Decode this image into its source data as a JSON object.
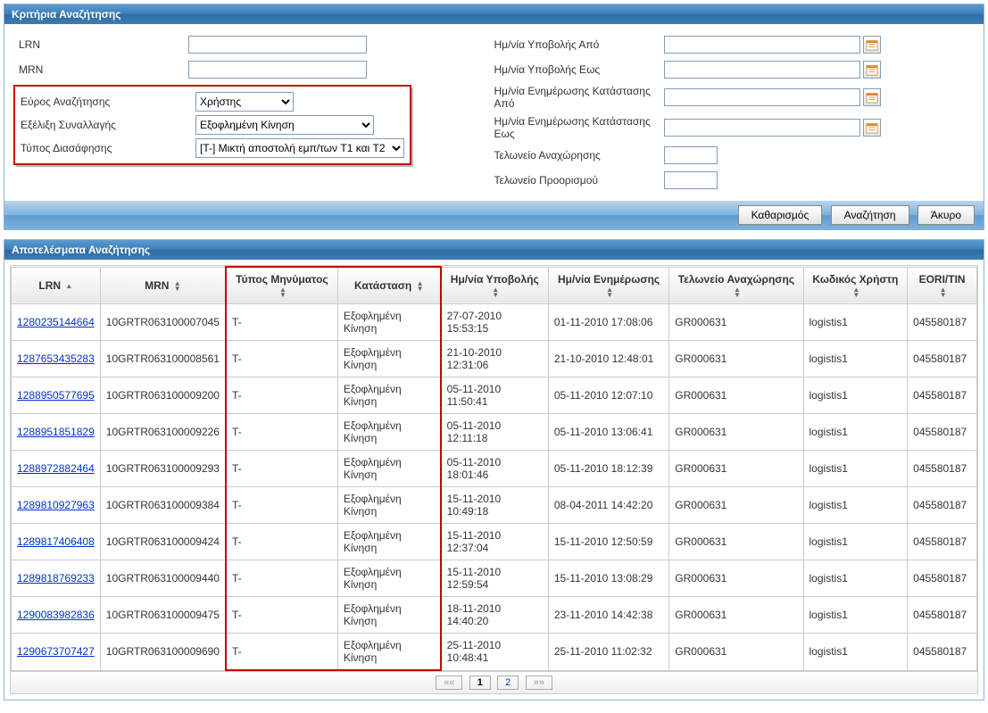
{
  "panels": {
    "criteria_title": "Κριτήρια Αναζήτησης",
    "results_title": "Αποτελέσματα Αναζήτησης"
  },
  "criteria": {
    "lrn_label": "LRN",
    "mrn_label": "MRN",
    "search_range_label": "Εύρος Αναζήτησης",
    "search_range_value": "Χρήστης",
    "transaction_progress_label": "Εξέλιξη Συναλλαγής",
    "transaction_progress_value": "Εξοφλημένη Κίνηση",
    "declaration_type_label": "Τύπος Διασάφησης",
    "declaration_type_value": "[T-] Μικτή αποστολή εμπ/των T1 και T2",
    "submit_date_from_label": "Ημ/νία Υποβολής Από",
    "submit_date_to_label": "Ημ/νία Υποβολής Εως",
    "status_update_from_label": "Ημ/νία Ενημέρωσης Κατάστασης Από",
    "status_update_to_label": "Ημ/νία Ενημέρωσης Κατάστασης Εως",
    "departure_customs_label": "Τελωνείο Αναχώρησης",
    "destination_customs_label": "Τελωνείο Προορισμού"
  },
  "buttons": {
    "clear": "Καθαρισμός",
    "search": "Αναζήτηση",
    "cancel": "Άκυρο"
  },
  "columns": {
    "lrn": "LRN",
    "mrn": "MRN",
    "msg_type": "Τύπος Μηνύματος",
    "status": "Κατάσταση",
    "submit_date": "Ημ/νία Υποβολής",
    "update_date": "Ημ/νία Ενημέρωσης",
    "departure_customs": "Τελωνείο Αναχώρησης",
    "user_code": "Κωδικός Χρήστη",
    "eori": "EORI/TIN"
  },
  "rows": [
    {
      "lrn": "1280235144664",
      "mrn": "10GRTR063100007045",
      "type": "T-",
      "status": "Εξοφλημένη Κίνηση",
      "submit": "27-07-2010 15:53:15",
      "update": "01-11-2010 17:08:06",
      "customs": "GR000631",
      "user": "logistis1",
      "eori": "045580187"
    },
    {
      "lrn": "1287653435283",
      "mrn": "10GRTR063100008561",
      "type": "T-",
      "status": "Εξοφλημένη Κίνηση",
      "submit": "21-10-2010 12:31:06",
      "update": "21-10-2010 12:48:01",
      "customs": "GR000631",
      "user": "logistis1",
      "eori": "045580187"
    },
    {
      "lrn": "1288950577695",
      "mrn": "10GRTR063100009200",
      "type": "T-",
      "status": "Εξοφλημένη Κίνηση",
      "submit": "05-11-2010 11:50:41",
      "update": "05-11-2010 12:07:10",
      "customs": "GR000631",
      "user": "logistis1",
      "eori": "045580187"
    },
    {
      "lrn": "1288951851829",
      "mrn": "10GRTR063100009226",
      "type": "T-",
      "status": "Εξοφλημένη Κίνηση",
      "submit": "05-11-2010 12:11:18",
      "update": "05-11-2010 13:06:41",
      "customs": "GR000631",
      "user": "logistis1",
      "eori": "045580187"
    },
    {
      "lrn": "1288972882464",
      "mrn": "10GRTR063100009293",
      "type": "T-",
      "status": "Εξοφλημένη Κίνηση",
      "submit": "05-11-2010 18:01:46",
      "update": "05-11-2010 18:12:39",
      "customs": "GR000631",
      "user": "logistis1",
      "eori": "045580187"
    },
    {
      "lrn": "1289810927963",
      "mrn": "10GRTR063100009384",
      "type": "T-",
      "status": "Εξοφλημένη Κίνηση",
      "submit": "15-11-2010 10:49:18",
      "update": "08-04-2011 14:42:20",
      "customs": "GR000631",
      "user": "logistis1",
      "eori": "045580187"
    },
    {
      "lrn": "1289817406408",
      "mrn": "10GRTR063100009424",
      "type": "T-",
      "status": "Εξοφλημένη Κίνηση",
      "submit": "15-11-2010 12:37:04",
      "update": "15-11-2010 12:50:59",
      "customs": "GR000631",
      "user": "logistis1",
      "eori": "045580187"
    },
    {
      "lrn": "1289818769233",
      "mrn": "10GRTR063100009440",
      "type": "T-",
      "status": "Εξοφλημένη Κίνηση",
      "submit": "15-11-2010 12:59:54",
      "update": "15-11-2010 13:08:29",
      "customs": "GR000631",
      "user": "logistis1",
      "eori": "045580187"
    },
    {
      "lrn": "1290083982836",
      "mrn": "10GRTR063100009475",
      "type": "T-",
      "status": "Εξοφλημένη Κίνηση",
      "submit": "18-11-2010 14:40:20",
      "update": "23-11-2010 14:42:38",
      "customs": "GR000631",
      "user": "logistis1",
      "eori": "045580187"
    },
    {
      "lrn": "1290673707427",
      "mrn": "10GRTR063100009690",
      "type": "T-",
      "status": "Εξοφλημένη Κίνηση",
      "submit": "25-11-2010 10:48:41",
      "update": "25-11-2010 11:02:32",
      "customs": "GR000631",
      "user": "logistis1",
      "eori": "045580187"
    }
  ],
  "pager": {
    "first": "««",
    "page1": "1",
    "page2": "2",
    "last": "»»"
  }
}
